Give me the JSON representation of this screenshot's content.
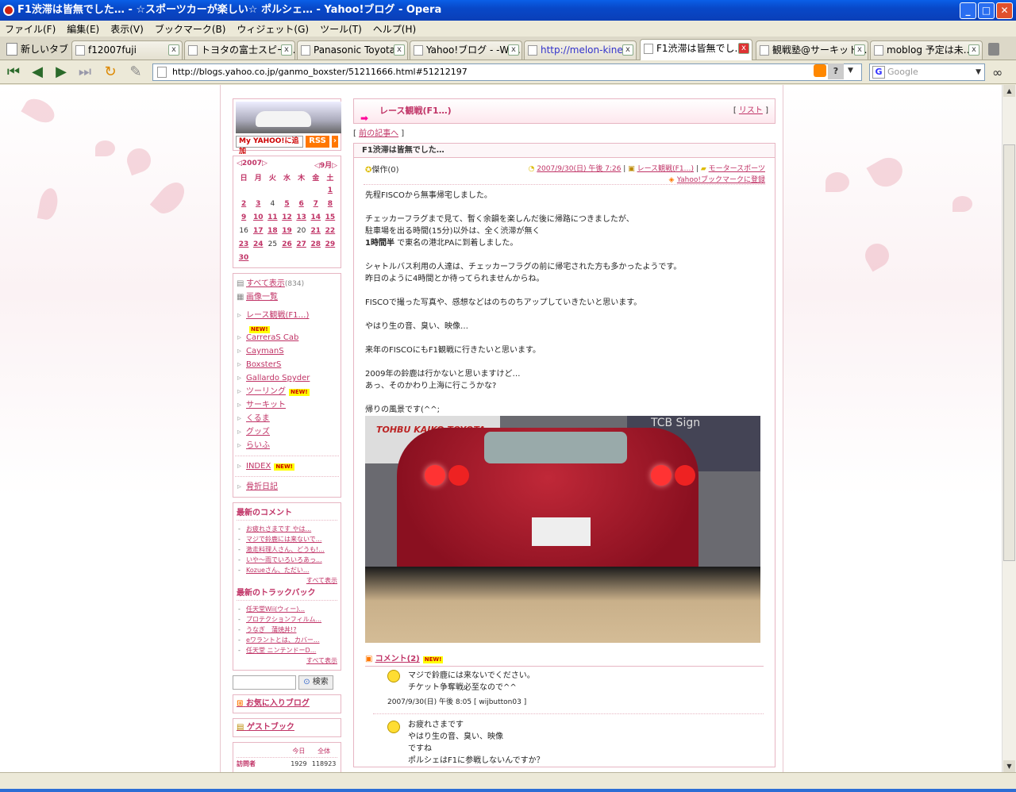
{
  "window": {
    "title": "F1渋滞は皆無でした… - ☆スポーツカーが楽しい☆ ポルシェ… - Yahoo!ブログ - Opera"
  },
  "menu": [
    "ファイル(F)",
    "編集(E)",
    "表示(V)",
    "ブックマーク(B)",
    "ウィジェット(G)",
    "ツール(T)",
    "ヘルプ(H)"
  ],
  "tabs": {
    "new_tab": "新しいタブ",
    "items": [
      "f12007fuji",
      "トヨタの富士スピー...",
      "Panasonic Toyota...",
      "Yahoo!ブログ - -Wi...",
      "http://melon-kine...",
      "F1渋滞は皆無でし...",
      "観戦塾@サーキット...",
      "moblog 予定は未..."
    ]
  },
  "address": {
    "url": "http://blogs.yahoo.co.jp/ganmo_boxster/51211666.html#51212197",
    "search_placeholder": "Google"
  },
  "sidebar": {
    "yahoo_add": "My YAHOO!に追加",
    "rss": "RSS",
    "calendar": {
      "year": "2007",
      "month": "9月",
      "weekdays": [
        "日",
        "月",
        "火",
        "水",
        "木",
        "金",
        "土"
      ],
      "rows": [
        [
          "",
          "",
          "",
          "",
          "",
          "",
          "1"
        ],
        [
          "2",
          "3",
          "4",
          "5",
          "6",
          "7",
          "8"
        ],
        [
          "9",
          "10",
          "11",
          "12",
          "13",
          "14",
          "15"
        ],
        [
          "16",
          "17",
          "18",
          "19",
          "20",
          "21",
          "22"
        ],
        [
          "23",
          "24",
          "25",
          "26",
          "27",
          "28",
          "29"
        ],
        [
          "30",
          "",
          "",
          "",
          "",
          "",
          ""
        ]
      ]
    },
    "all_posts": "すべて表示",
    "all_count": "(834)",
    "images": "画像一覧",
    "categories": [
      "レース観戦(F1…)",
      "CarreraS Cab",
      "CaymanS",
      "BoxsterS",
      "Gallardo Spyder",
      "ツーリング",
      "サーキット",
      "くるま",
      "グッズ",
      "らいふ"
    ],
    "index": "INDEX",
    "fracture": "骨折日記",
    "recent_comments_title": "最新のコメント",
    "recent_comments": [
      "お疲れさまです やは...",
      "マジで鈴鹿には来ないで...",
      "激走料理人さん、どうも!...",
      "いや〜雨でいろいろあっ...",
      "Kozueさん、ただい..."
    ],
    "show_all": "すべて表示",
    "recent_tb_title": "最新のトラックバック",
    "recent_tb": [
      "任天堂Wii(ウィー)...",
      "プロテクションフィルム...",
      "うなぎ　蒲焼丼!?",
      "eワラントとは、カバー...",
      "任天堂 ニンテンドーD..."
    ],
    "search_btn": "検索",
    "fav": "お気に入りブログ",
    "guestbook": "ゲストブック",
    "visitors": {
      "today_label": "今日",
      "total_label": "全体",
      "row_label": "訪問者",
      "today": "1929",
      "total": "118923"
    }
  },
  "main": {
    "category_header": "レース観戦(F1…)",
    "list_link": "リスト",
    "prev": "前の記事へ",
    "title": "F1渋滞は皆無でした…",
    "rating": "傑作(0)",
    "date": "2007/9/30(日) 午後 7:26",
    "cat": "レース観戦(F1…)",
    "subcat": "モータースポーツ",
    "bookmark": "Yahoo!ブックマークに登録",
    "paragraphs": [
      [
        "先程FISCOから無事帰宅しました。"
      ],
      [
        "チェッカーフラグまで見て、暫く余韻を楽しんだ後に帰路につきましたが、",
        "駐車場を出る時間(15分)以外は、全く渋滞が無く",
        "1時間半 で東名の港北PAに到着しました。"
      ],
      [
        "シャトルバス利用の人達は、チェッカーフラグの前に帰宅された方も多かったようです。",
        "昨日のように4時間とか待ってられませんからね。"
      ],
      [
        "FISCOで撮った写真や、感想などはのちのちアップしていきたいと思います。"
      ],
      [
        "やはり生の音、臭い、映像…"
      ],
      [
        "来年のFISCOにもF1観戦に行きたいと思います。"
      ],
      [
        "2009年の鈴鹿は行かないと思いますけど…",
        "あっ、そのかわり上海に行こうかな?"
      ],
      [
        "帰りの風景です(^^;"
      ]
    ],
    "bold_phrase": "1時間半",
    "photo_sign": "TOHBU KAIKO TOYOTA",
    "photo_sign2": "TCB Sign",
    "comments_label": "コメント(2)",
    "comments": [
      {
        "lines": [
          "マジで鈴鹿には来ないでください。",
          "チケット争奪戦必至なので^^"
        ],
        "meta": "2007/9/30(日) 午後 8:05 [ wijbutton03 ]"
      },
      {
        "lines": [
          "お疲れさまです",
          "やはり生の音、臭い、映像",
          "ですね",
          "ポルシェはF1に参戦しないんですか？"
        ],
        "meta": ""
      }
    ]
  }
}
